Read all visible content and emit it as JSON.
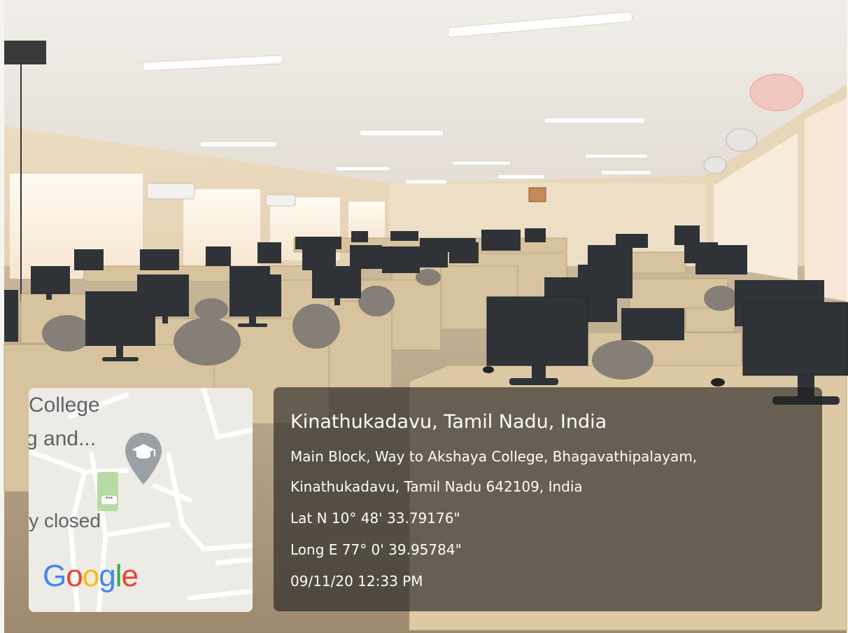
{
  "overlay": {
    "location_title": "Kinathukadavu, Tamil Nadu, India",
    "address_line1": "Main Block, Way to Akshaya College, Bhagavathipalayam,",
    "address_line2": "Kinathukadavu, Tamil Nadu 642109, India",
    "latitude": "Lat N 10° 48' 33.79176\"",
    "longitude": "Long E 77° 0' 39.95784\"",
    "datetime": "09/11/20 12:33 PM"
  },
  "map": {
    "label_line1": "College",
    "label_line2": "g and...",
    "label_line3": "ly closed",
    "brand": "Google",
    "pin_icon": "graduation-cap-pin-icon",
    "brand_colors": [
      "#4285F4",
      "#EA4335",
      "#FBBC05",
      "#4285F4",
      "#34A853",
      "#EA4335"
    ]
  },
  "scene": {
    "description_colors": {
      "wall": "#e9dcc4",
      "ceiling": "#ece7e0",
      "desk": "#d9c6a2",
      "monitor": "#2e3338",
      "floor": "#b7a58a"
    }
  }
}
